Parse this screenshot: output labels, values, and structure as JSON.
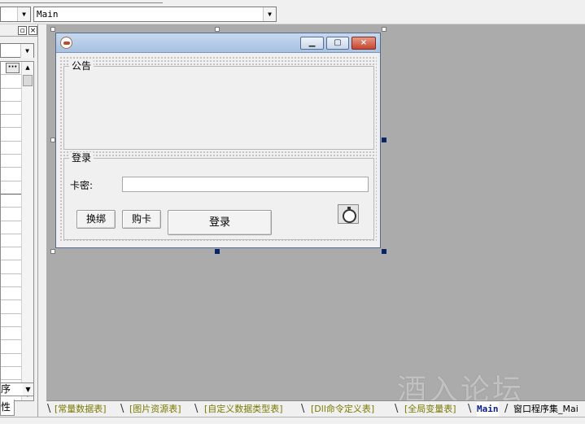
{
  "toolbar": {
    "object_combo_value": "",
    "method_combo_value": "Main"
  },
  "property_panel": {
    "ellipsis_label": "···",
    "sort_label": "序",
    "tab_label": "性"
  },
  "form": {
    "notice_group_label": "公告",
    "login_group_label": "登录",
    "card_key_label": "卡密:",
    "card_key_value": "",
    "rebind_button": "换绑",
    "buy_card_button": "购卡",
    "login_button": "登录"
  },
  "bottom_tabs": [
    {
      "label": "[常量数据表]"
    },
    {
      "label": "[图片资源表]"
    },
    {
      "label": "[自定义数据类型表]"
    },
    {
      "label": "[Dll命令定义表]"
    },
    {
      "label": "[全局变量表]"
    },
    {
      "label": "Main"
    },
    {
      "label": "窗口程序集_Mai"
    }
  ],
  "watermark": "酒入论坛",
  "colors": {
    "canvas": "#ababab",
    "titlebar": "#b7cde9",
    "active_tab_text": "#0a1f8f",
    "inactive_tab_text": "#7a7a00"
  }
}
